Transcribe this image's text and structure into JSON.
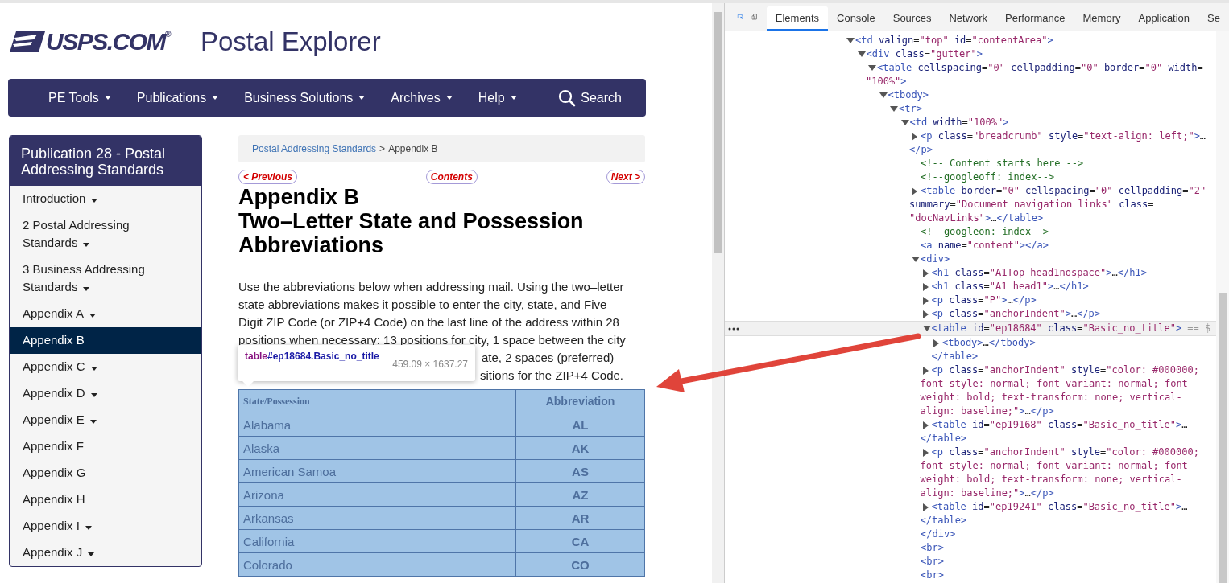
{
  "header": {
    "logo": "USPS.COM$^{®}$",
    "title": "Postal Explorer"
  },
  "nav": [
    {
      "label": "PE Tools",
      "kind": "menu",
      "dropdown": true
    },
    {
      "label": "Publications",
      "kind": "menu",
      "dropdown": true
    },
    {
      "label": "Business Solutions",
      "kind": "menu",
      "dropdown": true
    },
    {
      "label": "Archives",
      "kind": "menu",
      "dropdown": true
    },
    {
      "label": "Help",
      "kind": "menu",
      "dropdown": true
    },
    {
      "label": "Search",
      "kind": "search"
    }
  ],
  "sidebar": {
    "title": "Publication 28 - Postal Addressing Standards",
    "items": [
      {
        "label": "Introduction",
        "dropdown": true,
        "selected": false
      },
      {
        "label": "2 Postal Addressing Standards",
        "dropdown": true,
        "selected": false
      },
      {
        "label": "3 Business Addressing Standards",
        "dropdown": true,
        "selected": false
      },
      {
        "label": "Appendix A",
        "dropdown": true,
        "selected": false
      },
      {
        "label": "Appendix B",
        "dropdown": false,
        "selected": true
      },
      {
        "label": "Appendix C",
        "dropdown": true,
        "selected": false
      },
      {
        "label": "Appendix D",
        "dropdown": true,
        "selected": false
      },
      {
        "label": "Appendix E",
        "dropdown": true,
        "selected": false
      },
      {
        "label": "Appendix F",
        "dropdown": false,
        "selected": false
      },
      {
        "label": "Appendix G",
        "dropdown": false,
        "selected": false
      },
      {
        "label": "Appendix H",
        "dropdown": false,
        "selected": false
      },
      {
        "label": "Appendix I",
        "dropdown": true,
        "selected": false
      },
      {
        "label": "Appendix J",
        "dropdown": true,
        "selected": false
      }
    ]
  },
  "breadcrumb": {
    "link": "Postal Addressing Standards",
    "separator": ">",
    "current": "Appendix B"
  },
  "doc_nav": [
    "< Previous",
    "Contents",
    "Next >"
  ],
  "headings": [
    "Appendix B",
    "Two–Letter State and Possession Abbreviations"
  ],
  "paragraph": {
    "lines": [
      "Use the abbreviations below when addressing mail. Using the two–letter",
      "state abbreviations makes it possible to enter the city, state, and Five–",
      "Digit ZIP Code (or ZIP+4 Code) on the last line of the address within 28",
      "positions when necessary: 13 positions for city, 1 space between the city"
    ],
    "partial_lines": [
      "ate, 2 spaces (preferred)",
      "sitions for the ZIP+4 Code."
    ]
  },
  "tooltip": {
    "tag": "table",
    "selector": "#ep18684.Basic_no_title",
    "size": "459.09 × 1637.27"
  },
  "table": {
    "columns": [
      "State/Possession",
      "Abbreviation"
    ],
    "rows": [
      [
        "Alabama",
        "AL"
      ],
      [
        "Alaska",
        "AK"
      ],
      [
        "American Samoa",
        "AS"
      ],
      [
        "Arizona",
        "AZ"
      ],
      [
        "Arkansas",
        "AR"
      ],
      [
        "California",
        "CA"
      ],
      [
        "Colorado",
        "CO"
      ]
    ]
  },
  "devtools": {
    "tabs": [
      {
        "label": "Elements",
        "selected": true
      },
      {
        "label": "Console",
        "selected": false
      },
      {
        "label": "Sources",
        "selected": false
      },
      {
        "label": "Network",
        "selected": false
      },
      {
        "label": "Performance",
        "selected": false
      },
      {
        "label": "Memory",
        "selected": false
      },
      {
        "label": "Application",
        "selected": false
      },
      {
        "label": "Se",
        "selected": false
      }
    ],
    "tree": [
      {
        "lines": [
          "<td valign=\"top\" id=\"contentArea\">"
        ],
        "expanded": true,
        "selected": false,
        "children": [
          {
            "lines": [
              "<div class=\"gutter\">"
            ],
            "expanded": true,
            "selected": false,
            "children": [
              {
                "lines": [
                  "<table cellspacing=\"0\" cellpadding=\"0\" border=\"0\" width=",
                  "\"100%\">"
                ],
                "expanded": true,
                "selected": false,
                "children": [
                  {
                    "lines": [
                      "<tbody>"
                    ],
                    "expanded": true,
                    "selected": false,
                    "children": [
                      {
                        "lines": [
                          "<tr>"
                        ],
                        "expanded": true,
                        "selected": false,
                        "children": [
                          {
                            "lines": [
                              "<td width=\"100%\">"
                            ],
                            "expanded": true,
                            "selected": false,
                            "children": [
                              {
                                "lines": [
                                  "<p class=\"breadcrumb\" style=\"text-align: left;\">…",
                                  "</p>"
                                ],
                                "expanded": false,
                                "selected": false
                              },
                              {
                                "lines": [
                                  "<!-- Content starts here -->"
                                ],
                                "selected": false
                              },
                              {
                                "lines": [
                                  "<!--googleoff: index-->"
                                ],
                                "selected": false
                              },
                              {
                                "lines": [
                                  "<table border=\"0\" cellspacing=\"0\" cellpadding=\"2\"",
                                  "summary=\"Document navigation links\" class=",
                                  "\"docNavLinks\">…</table>"
                                ],
                                "expanded": false,
                                "selected": false
                              },
                              {
                                "lines": [
                                  "<!--googleon: index-->"
                                ],
                                "selected": false
                              },
                              {
                                "lines": [
                                  "<a name=\"content\"></a>"
                                ],
                                "selected": false
                              },
                              {
                                "lines": [
                                  "<div>"
                                ],
                                "expanded": true,
                                "selected": false,
                                "close": "</div>",
                                "children": [
                                  {
                                    "lines": [
                                      "<h1 class=\"A1Top head1nospace\">…</h1>"
                                    ],
                                    "expanded": false,
                                    "selected": false
                                  },
                                  {
                                    "lines": [
                                      "<h1 class=\"A1 head1\">…</h1>"
                                    ],
                                    "expanded": false,
                                    "selected": false
                                  },
                                  {
                                    "lines": [
                                      "<p class=\"P\">…</p>"
                                    ],
                                    "expanded": false,
                                    "selected": false
                                  },
                                  {
                                    "lines": [
                                      "<p class=\"anchorIndent\">…</p>"
                                    ],
                                    "expanded": false,
                                    "selected": false
                                  },
                                  {
                                    "lines": [
                                      "<table id=\"ep18684\" class=\"Basic_no_title\">"
                                    ],
                                    "suffix": "== $",
                                    "expanded": true,
                                    "selected": true,
                                    "close": "</table>",
                                    "children": [
                                      {
                                        "lines": [
                                          "<tbody>…</tbody>"
                                        ],
                                        "expanded": false,
                                        "selected": false
                                      }
                                    ]
                                  },
                                  {
                                    "lines": [
                                      "<p class=\"anchorIndent\" style=\"color: #000000;",
                                      "font-style: normal; font-variant: normal; font-",
                                      "weight: bold; text-transform: none; vertical-",
                                      "align: baseline;\">…</p>"
                                    ],
                                    "expanded": false,
                                    "selected": false
                                  },
                                  {
                                    "lines": [
                                      "<table id=\"ep19168\" class=\"Basic_no_title\">…",
                                      "</table>"
                                    ],
                                    "expanded": false,
                                    "selected": false
                                  },
                                  {
                                    "lines": [
                                      "<p class=\"anchorIndent\" style=\"color: #000000;",
                                      "font-style: normal; font-variant: normal; font-",
                                      "weight: bold; text-transform: none; vertical-",
                                      "align: baseline;\">…</p>"
                                    ],
                                    "expanded": false,
                                    "selected": false
                                  },
                                  {
                                    "lines": [
                                      "<table id=\"ep19241\" class=\"Basic_no_title\">…",
                                      "</table>"
                                    ],
                                    "expanded": false,
                                    "selected": false
                                  }
                                ]
                              },
                              {
                                "lines": [
                                  "<br>"
                                ],
                                "selected": false
                              },
                              {
                                "lines": [
                                  "<br>"
                                ],
                                "selected": false
                              },
                              {
                                "lines": [
                                  "<br>"
                                ],
                                "selected": false
                              }
                            ]
                          }
                        ]
                      }
                    ]
                  }
                ]
              }
            ]
          }
        ]
      }
    ]
  }
}
